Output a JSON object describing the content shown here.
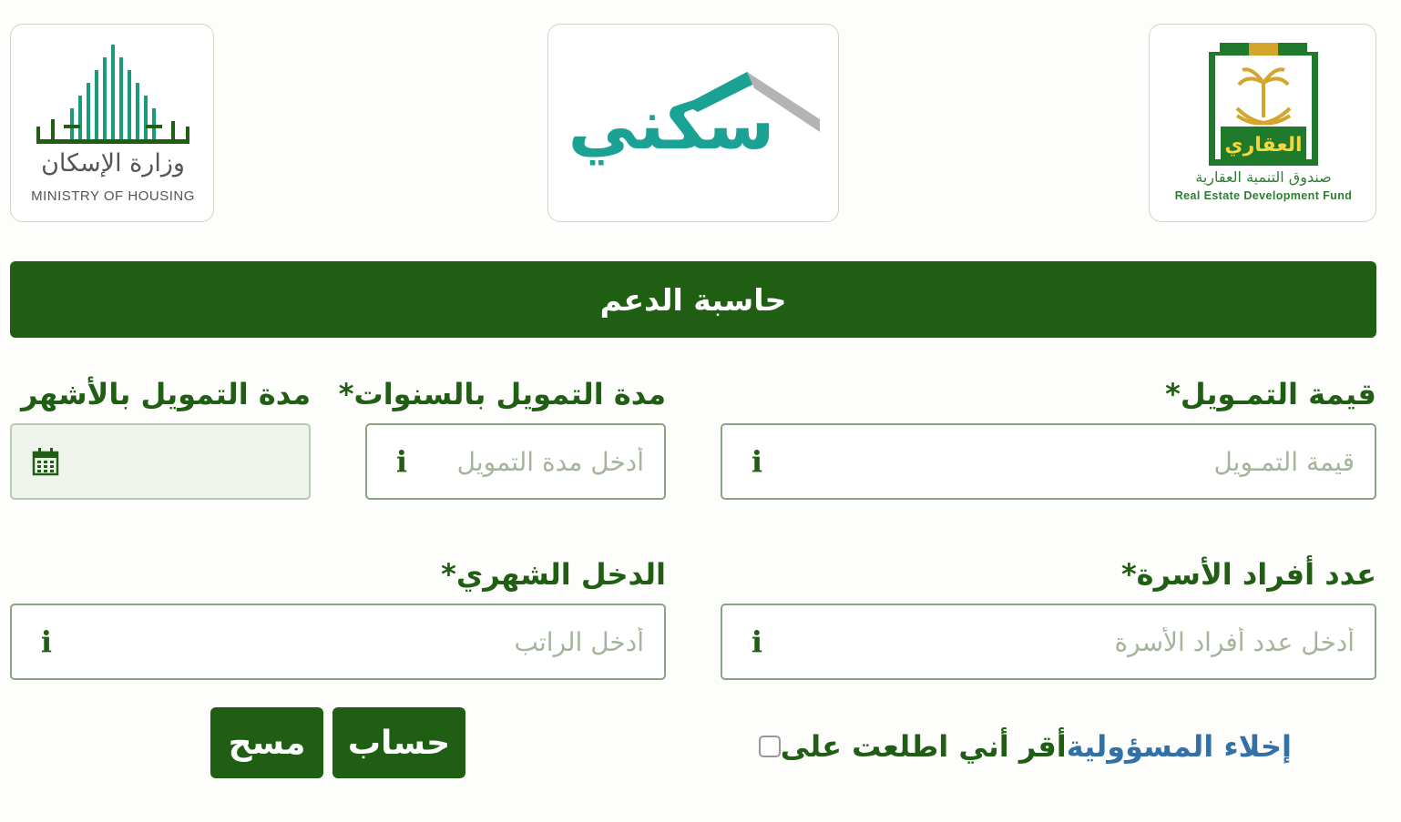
{
  "logos": {
    "moh": {
      "arabic": "وزارة الإسكان",
      "english": "MINISTRY OF HOUSING",
      "icon": "ministry-of-housing-logo"
    },
    "sakani": {
      "word": "سكني",
      "icon": "sakani-roof-logo"
    },
    "redf": {
      "emblem_text": "العقاري",
      "arabic": "صندوق التنمية العقارية",
      "english": "Real Estate Development Fund",
      "icon": "palm-swords-emblem"
    }
  },
  "header": {
    "title": "حاسبة الدعم"
  },
  "form": {
    "amount": {
      "label": "قيمة التمـويل*",
      "placeholder": "قيمة التمـويل"
    },
    "years": {
      "label": "مدة التمويل بالسنوات*",
      "placeholder": "أدخل مدة التمويل"
    },
    "months": {
      "label": "مدة التمويل بالأشهر",
      "placeholder": "",
      "icon": "calendar-icon"
    },
    "family": {
      "label": "عدد أفراد الأسرة*",
      "placeholder": "أدخل عدد أفراد الأسرة"
    },
    "income": {
      "label": "الدخل الشهري*",
      "placeholder": "أدخل الراتب"
    },
    "info_icon": "info-icon"
  },
  "agreement": {
    "text": "أقر أني اطلعت على",
    "link": "إخلاء المسؤولية"
  },
  "buttons": {
    "calculate": "حساب",
    "clear": "مسح"
  },
  "colors": {
    "primary": "#1f5e13",
    "teal": "#1aa394",
    "link": "#3271a8",
    "border": "#8aa57e"
  }
}
